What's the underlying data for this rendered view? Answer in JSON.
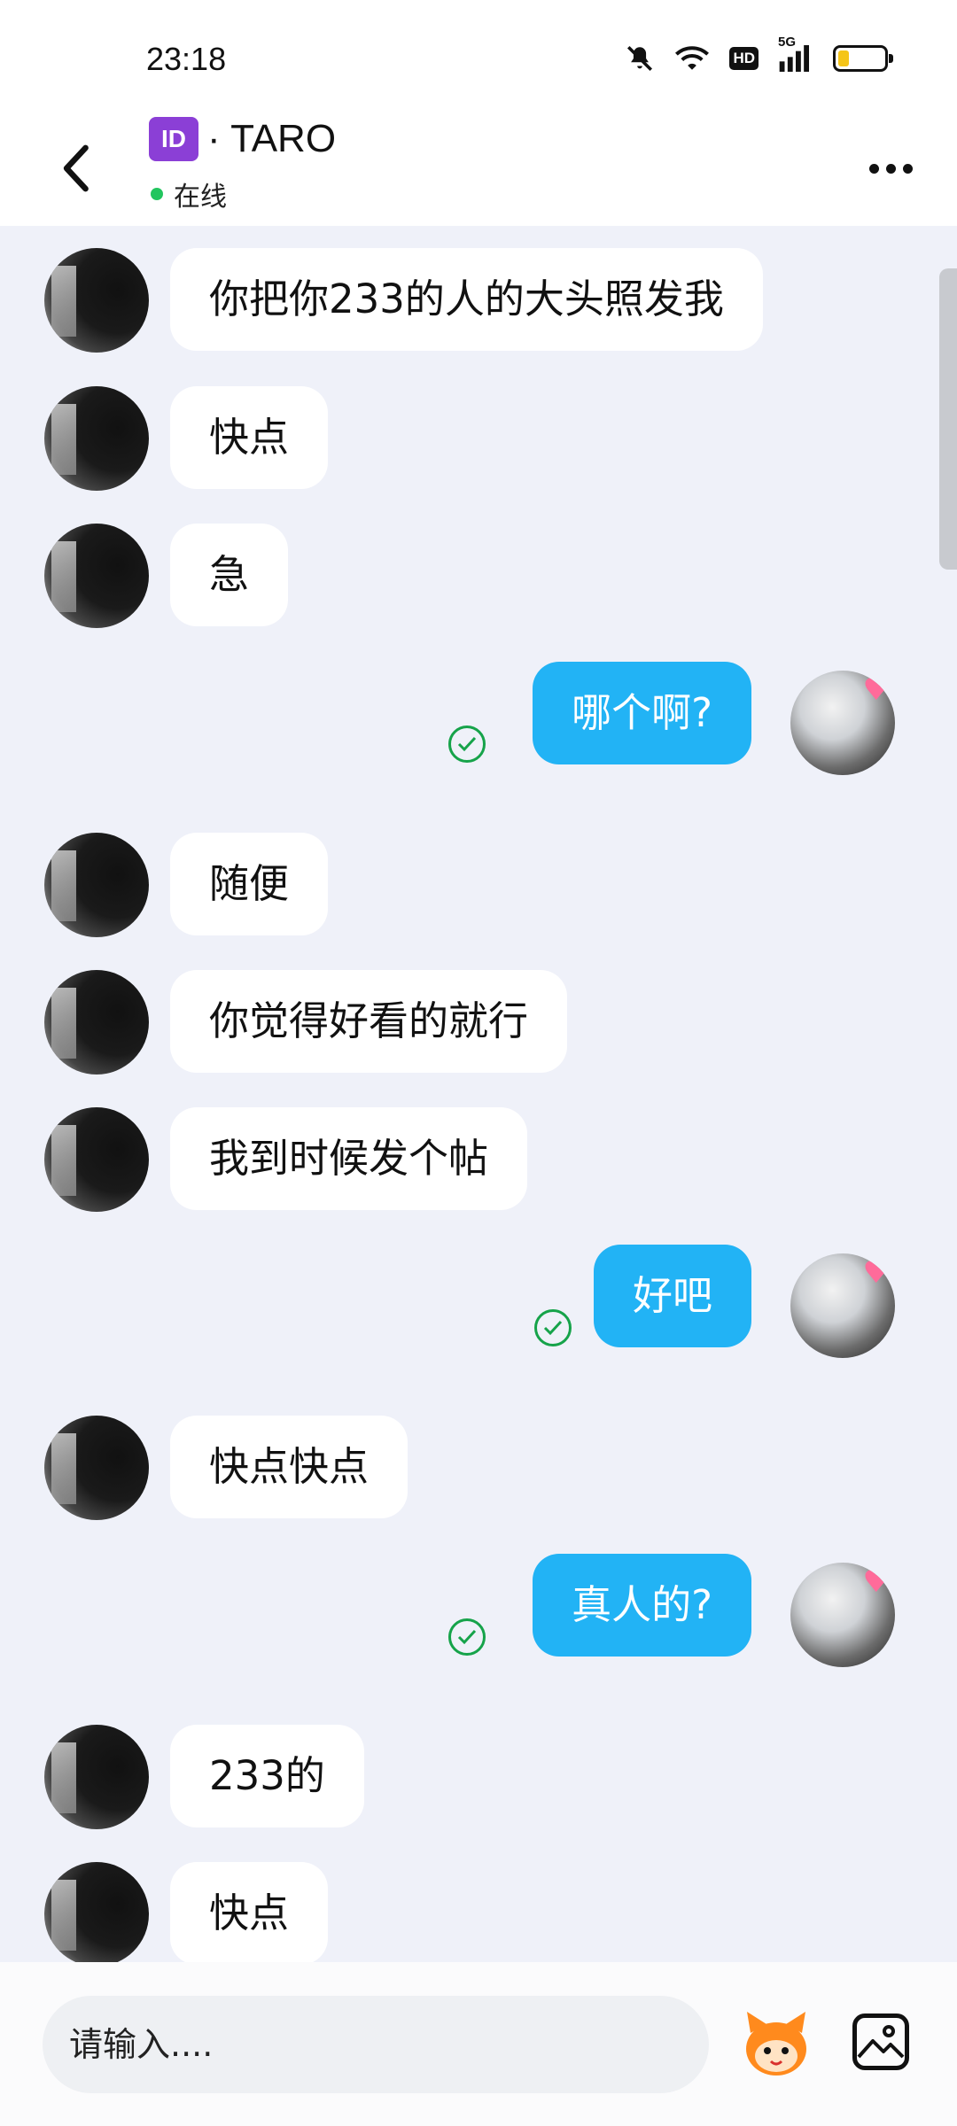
{
  "status_bar": {
    "time": "23:18",
    "hd_label": "HD",
    "network_label": "5G",
    "icons": [
      "mute-icon",
      "wifi-icon",
      "hd-icon",
      "signal-icon",
      "battery-icon"
    ],
    "battery_level": 0.2
  },
  "header": {
    "id_badge": "ID",
    "title": "· TARO",
    "status": "在线",
    "back_icon": "chevron-left-icon",
    "more_icon": "more-horizontal-icon"
  },
  "messages": [
    {
      "side": "in",
      "text": "你把你233的人的大头照发我"
    },
    {
      "side": "in",
      "text": "快点"
    },
    {
      "side": "in",
      "text": "急"
    },
    {
      "side": "out",
      "text": "哪个啊?",
      "read": true
    },
    {
      "side": "in",
      "text": "随便"
    },
    {
      "side": "in",
      "text": "你觉得好看的就行"
    },
    {
      "side": "in",
      "text": "我到时候发个帖"
    },
    {
      "side": "out",
      "text": "好吧",
      "read": true
    },
    {
      "side": "in",
      "text": "快点快点"
    },
    {
      "side": "out",
      "text": "真人的?",
      "read": true
    },
    {
      "side": "in",
      "text": "233的"
    },
    {
      "side": "in",
      "text": "快点"
    }
  ],
  "input": {
    "placeholder": "请输入...."
  },
  "colors": {
    "outgoing_bubble": "#22b3f5",
    "incoming_bubble": "#ffffff",
    "chat_background": "#eff1f9",
    "online": "#22c55e",
    "read_check": "#16a34a"
  }
}
